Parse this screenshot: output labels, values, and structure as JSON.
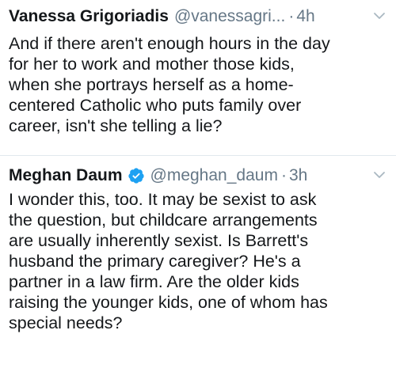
{
  "tweets": [
    {
      "name": "Vanessa Grigoriadis",
      "handle": "@vanessagri...",
      "separator": "·",
      "time": "4h",
      "verified": false,
      "lines": [
        "And if there aren't enough hours in the day",
        "for her to work and mother those kids,",
        "when she portrays herself as a home-",
        "centered Catholic who puts family over",
        "career, isn't she telling a lie?"
      ]
    },
    {
      "name": "Meghan Daum",
      "handle": "@meghan_daum",
      "separator": "·",
      "time": "3h",
      "verified": true,
      "lines": [
        "I wonder this, too. It may be sexist to ask",
        "the question, but childcare arrangements",
        "are usually inherently sexist. Is Barrett's",
        "husband the primary caregiver? He's a",
        "partner in a law firm. Are the older kids",
        "raising the younger kids, one of whom has",
        "special needs?"
      ]
    }
  ],
  "colors": {
    "text": "#14171a",
    "secondary": "#657786",
    "verified": "#1da1f2",
    "divider": "#e1e8ed"
  },
  "icons": {
    "verified": "verified-badge-icon",
    "more": "chevron-down-icon"
  }
}
